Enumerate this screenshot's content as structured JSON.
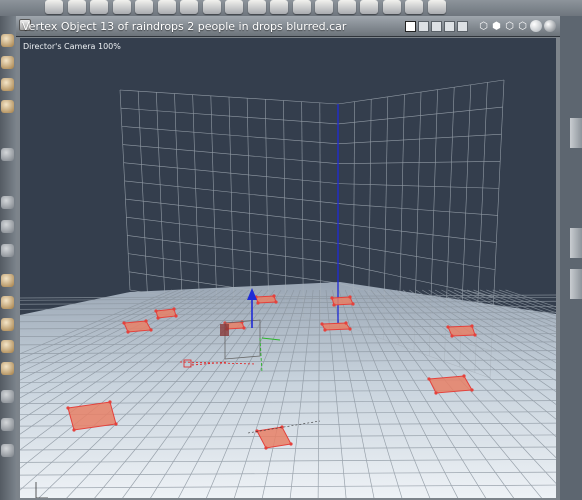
{
  "window": {
    "title": "Vertex Object 13 of raindrops 2 people in drops blurred.car"
  },
  "viewport": {
    "camera_label": "Director's Camera 100%",
    "scene_colors": {
      "background": "#343e4d",
      "floor": "#c7d2dc",
      "grid": "#8c96a0",
      "wall_grid": "#aab3bc",
      "selection": "#e4413c",
      "selection_fill": "#e88066",
      "axis_y": "#1f2bd6",
      "axis_x": "#e21f1f",
      "axis_z": "#2bb52b"
    }
  },
  "top_toolbar": {
    "icons": [
      "sphere-primitive-icon",
      "wireframe-tool-icon",
      "magnet-icon",
      "cut-tool-icon",
      "spline-icon",
      "pin-tool-icon",
      "lattice-tool-icon",
      "bevel-tool-icon",
      "clip-tool-icon",
      "chain-tool-icon",
      "twist-tool-icon",
      "ramp-tool-icon",
      "scale-tool-icon",
      "move-tool-icon",
      "rotate-tool-icon",
      "zoom-tool-icon",
      "render-tool-icon",
      "script-tool-icon"
    ]
  },
  "left_toolbar": {
    "icons": [
      "pointer-tool-icon",
      "pan-tool-icon",
      "orbit-tool-icon",
      "twist-tool-icon",
      "separator",
      "link-tool-icon",
      "camera-tool-icon",
      "hand-tool-icon",
      "magnify-tool-icon",
      "translate-tool-icon",
      "scale-tool-icon",
      "rotate-tool-icon",
      "taper-tool-icon",
      "box-tool-icon",
      "select-tool-icon",
      "eye-tool-icon",
      "draw-tool-icon"
    ]
  },
  "view_controls": {
    "layouts": [
      "single-view",
      "two-views-horizontal",
      "two-views-vertical",
      "three-views",
      "four-views"
    ],
    "shading": [
      "box-mode",
      "wireframe-mode",
      "smooth-mode",
      "sphere-mode",
      "lit-mode",
      "shaded-mode"
    ]
  }
}
